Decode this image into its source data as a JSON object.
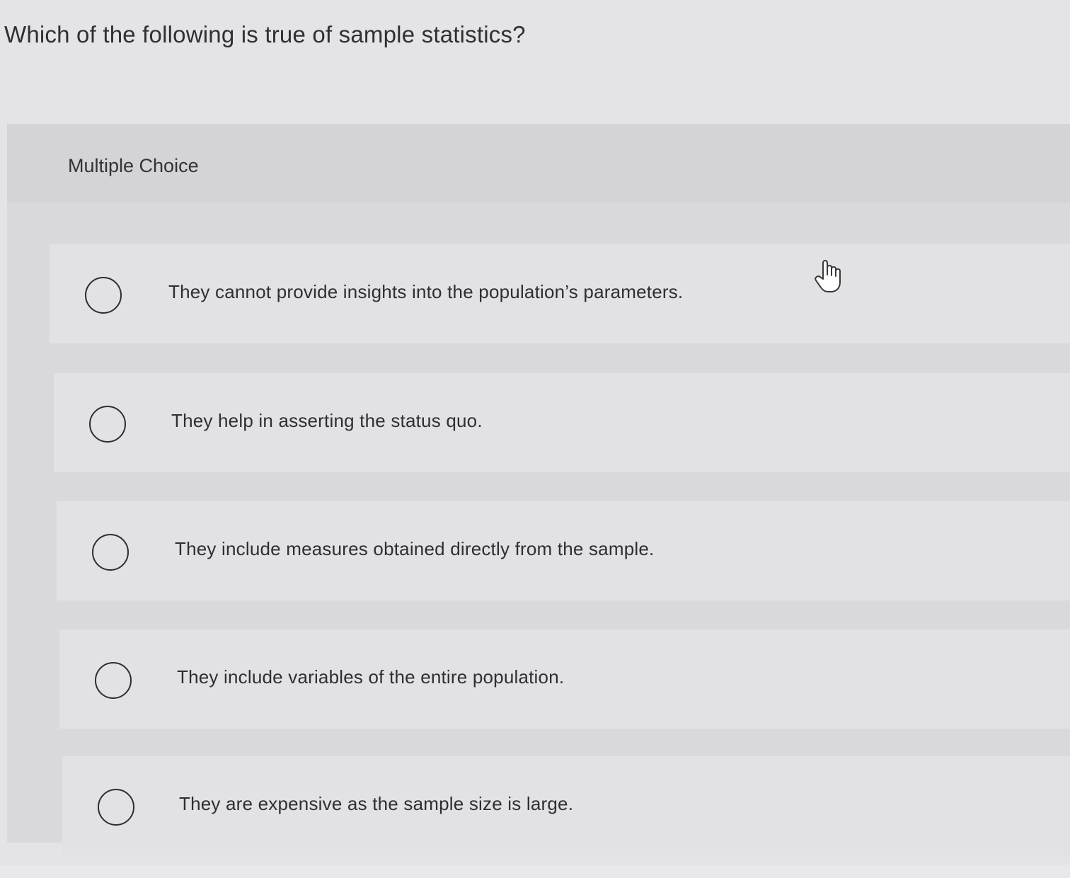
{
  "question": {
    "text": "Which of the following is true of sample statistics?"
  },
  "answer_panel": {
    "header_label": "Multiple Choice",
    "options": [
      {
        "label": "They cannot provide insights into the population’s parameters.",
        "selected": false
      },
      {
        "label": "They help in asserting the status quo.",
        "selected": false
      },
      {
        "label": "They include measures obtained directly from the sample.",
        "selected": false
      },
      {
        "label": "They include variables of the entire population.",
        "selected": false
      },
      {
        "label": "They are expensive as the sample size is large.",
        "selected": false
      }
    ]
  },
  "cursor": {
    "icon": "hand-pointer-icon"
  }
}
